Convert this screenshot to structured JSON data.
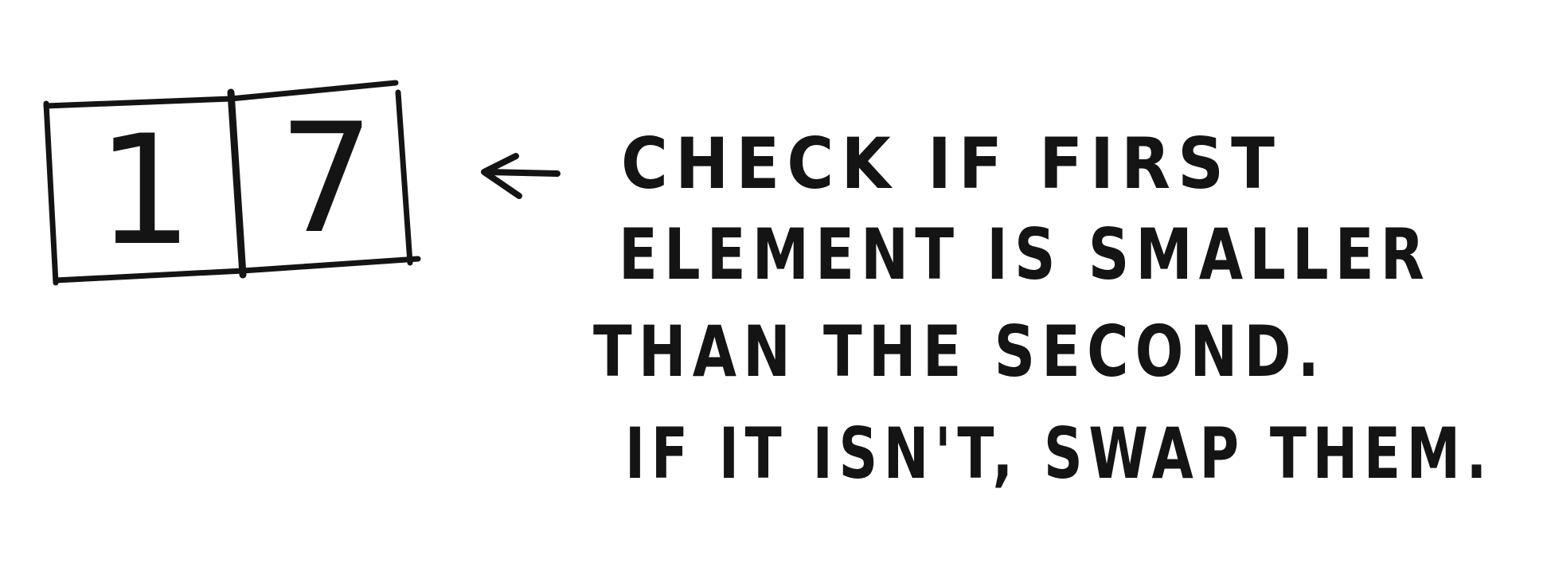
{
  "array": {
    "cells": [
      "1",
      "7"
    ]
  },
  "note": {
    "lines": [
      "CHECK IF FIRST",
      "ELEMENT IS SMALLER",
      "THAN THE SECOND.",
      "IF IT ISN'T, SWAP THEM."
    ]
  },
  "ink_color": "#141414",
  "icons": {
    "pointer": "left-arrow-icon"
  }
}
